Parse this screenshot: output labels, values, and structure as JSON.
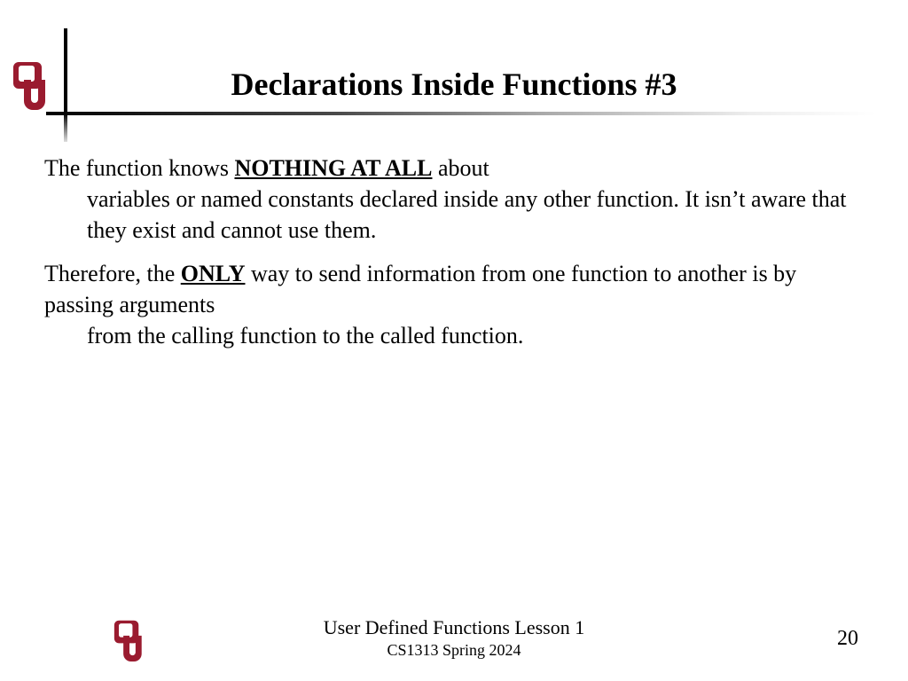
{
  "header": {
    "title": "Declarations Inside Functions #3",
    "logo_name": "ou-logo"
  },
  "body": {
    "p1_lead": "The function knows ",
    "p1_emph": "NOTHING AT ALL",
    "p1_after": " about",
    "p1_cont": "variables or named constants declared inside any other function. It isn’t aware that they exist and cannot use them.",
    "p2_lead": "Therefore, the ",
    "p2_emph": "ONLY",
    "p2_after": " way to send information from one function to another is by passing arguments",
    "p2_cont": "from the calling function to the called function."
  },
  "footer": {
    "line1": "User Defined Functions Lesson 1",
    "line2": "CS1313 Spring 2024",
    "page": "20"
  },
  "colors": {
    "crimson": "#9a1b2f"
  }
}
